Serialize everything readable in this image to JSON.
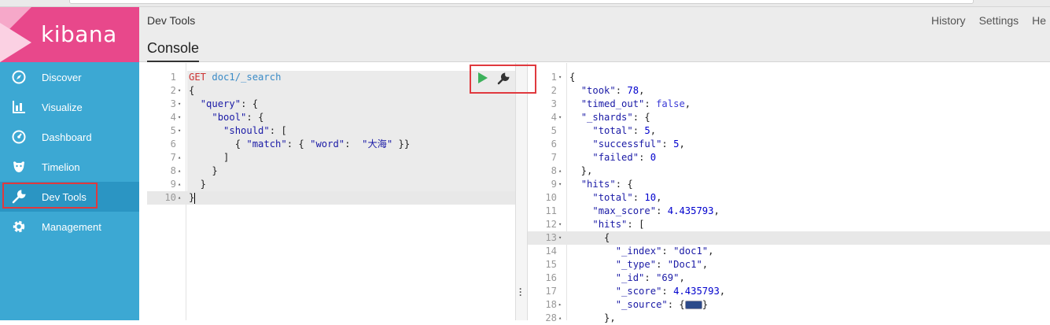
{
  "app": {
    "logo_text": "kibana",
    "page_title": "Dev Tools",
    "tab": "Console"
  },
  "header_links": [
    "History",
    "Settings",
    "He"
  ],
  "nav": [
    {
      "label": "Discover",
      "icon": "compass-icon"
    },
    {
      "label": "Visualize",
      "icon": "bar-chart-icon"
    },
    {
      "label": "Dashboard",
      "icon": "dashboard-gauge-icon"
    },
    {
      "label": "Timelion",
      "icon": "timelion-icon"
    },
    {
      "label": "Dev Tools",
      "icon": "wrench-icon"
    },
    {
      "label": "Management",
      "icon": "gear-icon"
    }
  ],
  "request": {
    "lines": [
      {
        "n": "1",
        "fold": "",
        "tokens": [
          [
            "m",
            "GET "
          ],
          [
            "u",
            "doc1/_search"
          ]
        ]
      },
      {
        "n": "2",
        "fold": "▾",
        "tokens": [
          [
            "",
            "{"
          ]
        ]
      },
      {
        "n": "3",
        "fold": "▾",
        "tokens": [
          [
            "",
            "  "
          ],
          [
            "s",
            "\"query\""
          ],
          [
            "",
            ": {"
          ]
        ]
      },
      {
        "n": "4",
        "fold": "▾",
        "tokens": [
          [
            "",
            "    "
          ],
          [
            "s",
            "\"bool\""
          ],
          [
            "",
            ": {"
          ]
        ]
      },
      {
        "n": "5",
        "fold": "▾",
        "tokens": [
          [
            "",
            "      "
          ],
          [
            "s",
            "\"should\""
          ],
          [
            "",
            ": ["
          ]
        ]
      },
      {
        "n": "6",
        "fold": "",
        "tokens": [
          [
            "",
            "        { "
          ],
          [
            "s",
            "\"match\""
          ],
          [
            "",
            ": { "
          ],
          [
            "s",
            "\"word\""
          ],
          [
            "",
            ":  "
          ],
          [
            "s",
            "\"大海\""
          ],
          [
            "",
            " }}"
          ]
        ]
      },
      {
        "n": "7",
        "fold": "▴",
        "tokens": [
          [
            "",
            "      ]"
          ]
        ]
      },
      {
        "n": "8",
        "fold": "▴",
        "tokens": [
          [
            "",
            "    }"
          ]
        ]
      },
      {
        "n": "9",
        "fold": "▴",
        "tokens": [
          [
            "",
            "  }"
          ]
        ]
      },
      {
        "n": "10",
        "fold": "▴",
        "tokens": [
          [
            "",
            "}"
          ]
        ]
      }
    ]
  },
  "response": {
    "lines": [
      {
        "n": "1",
        "fold": "▾",
        "tokens": [
          [
            "",
            "{"
          ]
        ]
      },
      {
        "n": "2",
        "fold": "",
        "tokens": [
          [
            "",
            "  "
          ],
          [
            "s",
            "\"took\""
          ],
          [
            "",
            ": "
          ],
          [
            "n",
            "78"
          ],
          [
            "",
            ","
          ]
        ]
      },
      {
        "n": "3",
        "fold": "",
        "tokens": [
          [
            "",
            "  "
          ],
          [
            "s",
            "\"timed_out\""
          ],
          [
            "",
            ": "
          ],
          [
            "b",
            "false"
          ],
          [
            "",
            ","
          ]
        ]
      },
      {
        "n": "4",
        "fold": "▾",
        "tokens": [
          [
            "",
            "  "
          ],
          [
            "s",
            "\"_shards\""
          ],
          [
            "",
            ": {"
          ]
        ]
      },
      {
        "n": "5",
        "fold": "",
        "tokens": [
          [
            "",
            "    "
          ],
          [
            "s",
            "\"total\""
          ],
          [
            "",
            ": "
          ],
          [
            "n",
            "5"
          ],
          [
            "",
            ","
          ]
        ]
      },
      {
        "n": "6",
        "fold": "",
        "tokens": [
          [
            "",
            "    "
          ],
          [
            "s",
            "\"successful\""
          ],
          [
            "",
            ": "
          ],
          [
            "n",
            "5"
          ],
          [
            "",
            ","
          ]
        ]
      },
      {
        "n": "7",
        "fold": "",
        "tokens": [
          [
            "",
            "    "
          ],
          [
            "s",
            "\"failed\""
          ],
          [
            "",
            ": "
          ],
          [
            "n",
            "0"
          ]
        ]
      },
      {
        "n": "8",
        "fold": "▴",
        "tokens": [
          [
            "",
            "  },"
          ]
        ]
      },
      {
        "n": "9",
        "fold": "▾",
        "tokens": [
          [
            "",
            "  "
          ],
          [
            "s",
            "\"hits\""
          ],
          [
            "",
            ": {"
          ]
        ]
      },
      {
        "n": "10",
        "fold": "",
        "tokens": [
          [
            "",
            "    "
          ],
          [
            "s",
            "\"total\""
          ],
          [
            "",
            ": "
          ],
          [
            "n",
            "10"
          ],
          [
            "",
            ","
          ]
        ]
      },
      {
        "n": "11",
        "fold": "",
        "tokens": [
          [
            "",
            "    "
          ],
          [
            "s",
            "\"max_score\""
          ],
          [
            "",
            ": "
          ],
          [
            "n",
            "4.435793"
          ],
          [
            "",
            ","
          ]
        ]
      },
      {
        "n": "12",
        "fold": "▾",
        "tokens": [
          [
            "",
            "    "
          ],
          [
            "s",
            "\"hits\""
          ],
          [
            "",
            ": ["
          ]
        ]
      },
      {
        "n": "13",
        "fold": "▾",
        "tokens": [
          [
            "",
            "      {"
          ]
        ]
      },
      {
        "n": "14",
        "fold": "",
        "tokens": [
          [
            "",
            "        "
          ],
          [
            "s",
            "\"_index\""
          ],
          [
            "",
            ": "
          ],
          [
            "s",
            "\"doc1\""
          ],
          [
            "",
            ","
          ]
        ]
      },
      {
        "n": "15",
        "fold": "",
        "tokens": [
          [
            "",
            "        "
          ],
          [
            "s",
            "\"_type\""
          ],
          [
            "",
            ": "
          ],
          [
            "s",
            "\"Doc1\""
          ],
          [
            "",
            ","
          ]
        ]
      },
      {
        "n": "16",
        "fold": "",
        "tokens": [
          [
            "",
            "        "
          ],
          [
            "s",
            "\"_id\""
          ],
          [
            "",
            ": "
          ],
          [
            "s",
            "\"69\""
          ],
          [
            "",
            ","
          ]
        ]
      },
      {
        "n": "17",
        "fold": "",
        "tokens": [
          [
            "",
            "        "
          ],
          [
            "s",
            "\"_score\""
          ],
          [
            "",
            ": "
          ],
          [
            "n",
            "4.435793"
          ],
          [
            "",
            ","
          ]
        ]
      },
      {
        "n": "18",
        "fold": "▸",
        "tokens": [
          [
            "",
            "        "
          ],
          [
            "s",
            "\"_source\""
          ],
          [
            "",
            ": {"
          ],
          [
            "collapsed",
            ""
          ],
          [
            "",
            "}"
          ]
        ]
      },
      {
        "n": "28",
        "fold": "▴",
        "tokens": [
          [
            "",
            "      },"
          ]
        ]
      }
    ]
  },
  "colors": {
    "sidebar": "#3ca8d3",
    "logo_bg": "#e8488b",
    "active_nav": "#2b95c3",
    "highlight_box": "#e0393e",
    "run_button": "#3cb15b"
  }
}
